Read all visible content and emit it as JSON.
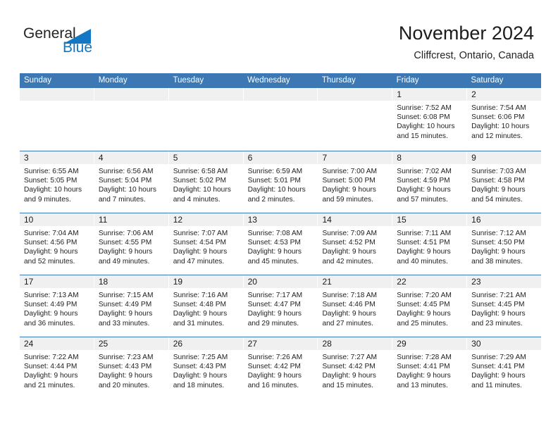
{
  "logo": {
    "text_primary": "General",
    "text_secondary": "Blue",
    "triangle_icon": "blue-triangle-icon",
    "primary_color": "#232323",
    "secondary_color": "#1277c4"
  },
  "header": {
    "title": "November 2024",
    "subtitle": "Cliffcrest, Ontario, Canada"
  },
  "theme": {
    "header_bar_color": "#3c78b4",
    "date_strip_color": "#f0f0f0",
    "week_divider_color": "#3c78b4",
    "text_color": "#1a1a1a"
  },
  "weekdays": [
    "Sunday",
    "Monday",
    "Tuesday",
    "Wednesday",
    "Thursday",
    "Friday",
    "Saturday"
  ],
  "labels": {
    "sunrise_prefix": "Sunrise:",
    "sunset_prefix": "Sunset:",
    "daylight_prefix": "Daylight:"
  },
  "weeks": [
    [
      {
        "day": "",
        "empty": true
      },
      {
        "day": "",
        "empty": true
      },
      {
        "day": "",
        "empty": true
      },
      {
        "day": "",
        "empty": true
      },
      {
        "day": "",
        "empty": true
      },
      {
        "day": "1",
        "sunrise": "Sunrise: 7:52 AM",
        "sunset": "Sunset: 6:08 PM",
        "daylight_1": "Daylight: 10 hours",
        "daylight_2": "and 15 minutes."
      },
      {
        "day": "2",
        "sunrise": "Sunrise: 7:54 AM",
        "sunset": "Sunset: 6:06 PM",
        "daylight_1": "Daylight: 10 hours",
        "daylight_2": "and 12 minutes."
      }
    ],
    [
      {
        "day": "3",
        "sunrise": "Sunrise: 6:55 AM",
        "sunset": "Sunset: 5:05 PM",
        "daylight_1": "Daylight: 10 hours",
        "daylight_2": "and 9 minutes."
      },
      {
        "day": "4",
        "sunrise": "Sunrise: 6:56 AM",
        "sunset": "Sunset: 5:04 PM",
        "daylight_1": "Daylight: 10 hours",
        "daylight_2": "and 7 minutes."
      },
      {
        "day": "5",
        "sunrise": "Sunrise: 6:58 AM",
        "sunset": "Sunset: 5:02 PM",
        "daylight_1": "Daylight: 10 hours",
        "daylight_2": "and 4 minutes."
      },
      {
        "day": "6",
        "sunrise": "Sunrise: 6:59 AM",
        "sunset": "Sunset: 5:01 PM",
        "daylight_1": "Daylight: 10 hours",
        "daylight_2": "and 2 minutes."
      },
      {
        "day": "7",
        "sunrise": "Sunrise: 7:00 AM",
        "sunset": "Sunset: 5:00 PM",
        "daylight_1": "Daylight: 9 hours",
        "daylight_2": "and 59 minutes."
      },
      {
        "day": "8",
        "sunrise": "Sunrise: 7:02 AM",
        "sunset": "Sunset: 4:59 PM",
        "daylight_1": "Daylight: 9 hours",
        "daylight_2": "and 57 minutes."
      },
      {
        "day": "9",
        "sunrise": "Sunrise: 7:03 AM",
        "sunset": "Sunset: 4:58 PM",
        "daylight_1": "Daylight: 9 hours",
        "daylight_2": "and 54 minutes."
      }
    ],
    [
      {
        "day": "10",
        "sunrise": "Sunrise: 7:04 AM",
        "sunset": "Sunset: 4:56 PM",
        "daylight_1": "Daylight: 9 hours",
        "daylight_2": "and 52 minutes."
      },
      {
        "day": "11",
        "sunrise": "Sunrise: 7:06 AM",
        "sunset": "Sunset: 4:55 PM",
        "daylight_1": "Daylight: 9 hours",
        "daylight_2": "and 49 minutes."
      },
      {
        "day": "12",
        "sunrise": "Sunrise: 7:07 AM",
        "sunset": "Sunset: 4:54 PM",
        "daylight_1": "Daylight: 9 hours",
        "daylight_2": "and 47 minutes."
      },
      {
        "day": "13",
        "sunrise": "Sunrise: 7:08 AM",
        "sunset": "Sunset: 4:53 PM",
        "daylight_1": "Daylight: 9 hours",
        "daylight_2": "and 45 minutes."
      },
      {
        "day": "14",
        "sunrise": "Sunrise: 7:09 AM",
        "sunset": "Sunset: 4:52 PM",
        "daylight_1": "Daylight: 9 hours",
        "daylight_2": "and 42 minutes."
      },
      {
        "day": "15",
        "sunrise": "Sunrise: 7:11 AM",
        "sunset": "Sunset: 4:51 PM",
        "daylight_1": "Daylight: 9 hours",
        "daylight_2": "and 40 minutes."
      },
      {
        "day": "16",
        "sunrise": "Sunrise: 7:12 AM",
        "sunset": "Sunset: 4:50 PM",
        "daylight_1": "Daylight: 9 hours",
        "daylight_2": "and 38 minutes."
      }
    ],
    [
      {
        "day": "17",
        "sunrise": "Sunrise: 7:13 AM",
        "sunset": "Sunset: 4:49 PM",
        "daylight_1": "Daylight: 9 hours",
        "daylight_2": "and 36 minutes."
      },
      {
        "day": "18",
        "sunrise": "Sunrise: 7:15 AM",
        "sunset": "Sunset: 4:49 PM",
        "daylight_1": "Daylight: 9 hours",
        "daylight_2": "and 33 minutes."
      },
      {
        "day": "19",
        "sunrise": "Sunrise: 7:16 AM",
        "sunset": "Sunset: 4:48 PM",
        "daylight_1": "Daylight: 9 hours",
        "daylight_2": "and 31 minutes."
      },
      {
        "day": "20",
        "sunrise": "Sunrise: 7:17 AM",
        "sunset": "Sunset: 4:47 PM",
        "daylight_1": "Daylight: 9 hours",
        "daylight_2": "and 29 minutes."
      },
      {
        "day": "21",
        "sunrise": "Sunrise: 7:18 AM",
        "sunset": "Sunset: 4:46 PM",
        "daylight_1": "Daylight: 9 hours",
        "daylight_2": "and 27 minutes."
      },
      {
        "day": "22",
        "sunrise": "Sunrise: 7:20 AM",
        "sunset": "Sunset: 4:45 PM",
        "daylight_1": "Daylight: 9 hours",
        "daylight_2": "and 25 minutes."
      },
      {
        "day": "23",
        "sunrise": "Sunrise: 7:21 AM",
        "sunset": "Sunset: 4:45 PM",
        "daylight_1": "Daylight: 9 hours",
        "daylight_2": "and 23 minutes."
      }
    ],
    [
      {
        "day": "24",
        "sunrise": "Sunrise: 7:22 AM",
        "sunset": "Sunset: 4:44 PM",
        "daylight_1": "Daylight: 9 hours",
        "daylight_2": "and 21 minutes."
      },
      {
        "day": "25",
        "sunrise": "Sunrise: 7:23 AM",
        "sunset": "Sunset: 4:43 PM",
        "daylight_1": "Daylight: 9 hours",
        "daylight_2": "and 20 minutes."
      },
      {
        "day": "26",
        "sunrise": "Sunrise: 7:25 AM",
        "sunset": "Sunset: 4:43 PM",
        "daylight_1": "Daylight: 9 hours",
        "daylight_2": "and 18 minutes."
      },
      {
        "day": "27",
        "sunrise": "Sunrise: 7:26 AM",
        "sunset": "Sunset: 4:42 PM",
        "daylight_1": "Daylight: 9 hours",
        "daylight_2": "and 16 minutes."
      },
      {
        "day": "28",
        "sunrise": "Sunrise: 7:27 AM",
        "sunset": "Sunset: 4:42 PM",
        "daylight_1": "Daylight: 9 hours",
        "daylight_2": "and 15 minutes."
      },
      {
        "day": "29",
        "sunrise": "Sunrise: 7:28 AM",
        "sunset": "Sunset: 4:41 PM",
        "daylight_1": "Daylight: 9 hours",
        "daylight_2": "and 13 minutes."
      },
      {
        "day": "30",
        "sunrise": "Sunrise: 7:29 AM",
        "sunset": "Sunset: 4:41 PM",
        "daylight_1": "Daylight: 9 hours",
        "daylight_2": "and 11 minutes."
      }
    ]
  ]
}
